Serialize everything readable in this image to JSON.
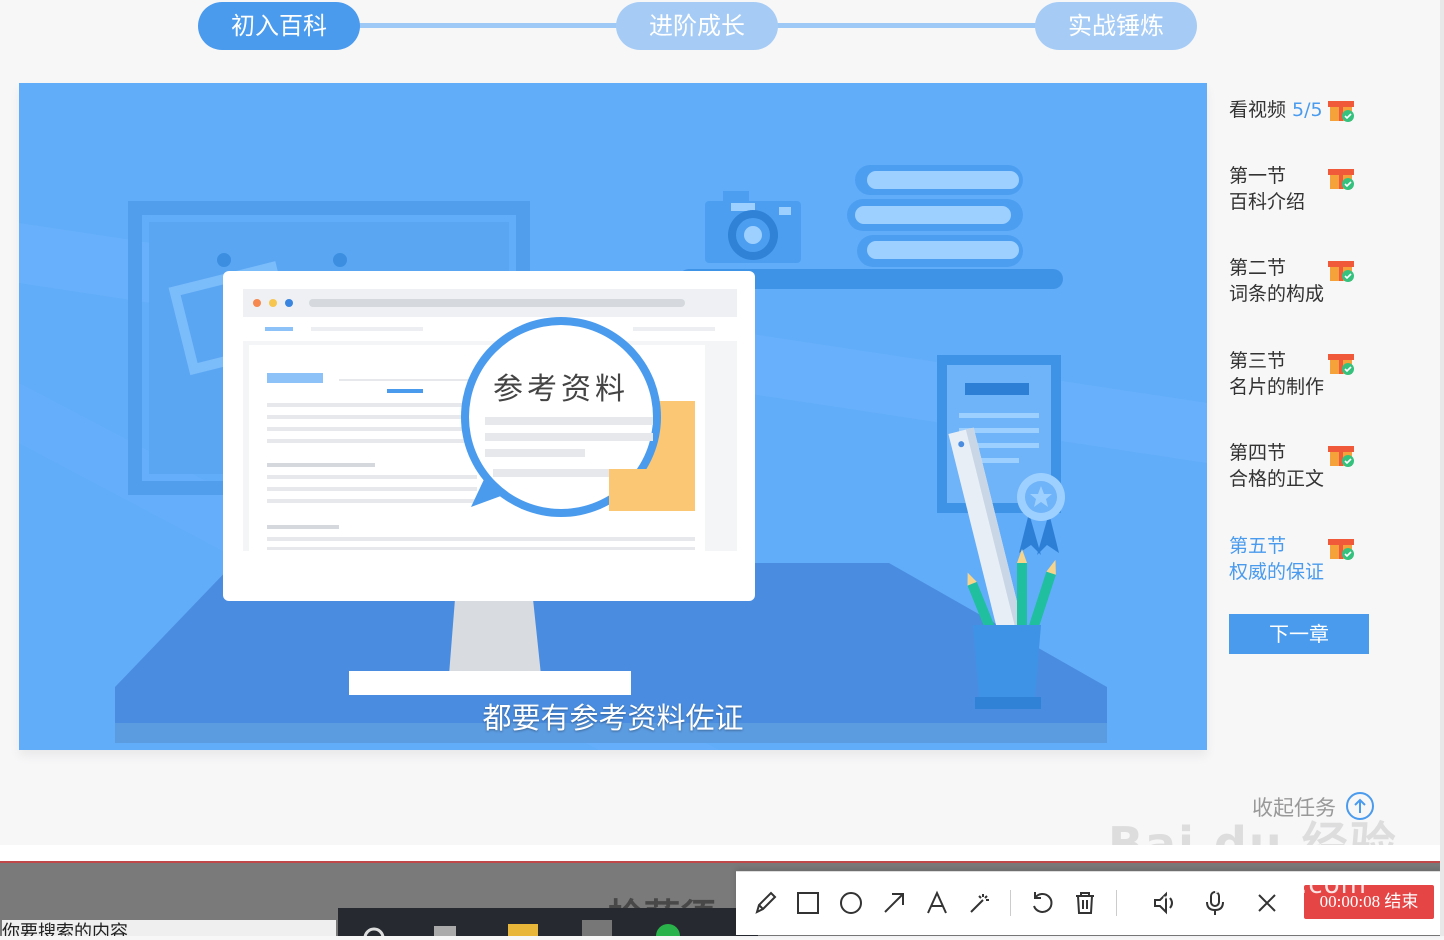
{
  "stepper": {
    "steps": [
      "初入百科",
      "进阶成长",
      "实战锤炼"
    ],
    "active_index": 0
  },
  "video": {
    "subtitle": "都要有参考资料佐证",
    "bubble_text": "参考资料",
    "colors": {
      "background": "#62adfa",
      "accent": "#4a9bee"
    }
  },
  "sidebar": {
    "video_label": "看视频",
    "video_progress": "5/5",
    "sections": [
      {
        "line1": "第一节",
        "line2": "百科介绍",
        "current": false
      },
      {
        "line1": "第二节",
        "line2": "词条的构成",
        "current": false
      },
      {
        "line1": "第三节",
        "line2": "名片的制作",
        "current": false
      },
      {
        "line1": "第四节",
        "line2": "合格的正文",
        "current": false
      },
      {
        "line1": "第五节",
        "line2": "权威的保证",
        "current": true
      }
    ],
    "next_button": "下一章",
    "collapse_label": "收起任务"
  },
  "watermark": {
    "logo": "Bai du 经验",
    "url": "jingyan.baidu.com"
  },
  "background_window": {
    "search_hint": "你要搜索的内容",
    "title_fragment": "检萨须"
  },
  "recorder": {
    "tools": [
      "pencil-icon",
      "rectangle-icon",
      "circle-icon",
      "arrow-icon",
      "text-icon",
      "magic-wand-icon",
      "undo-icon",
      "trash-icon",
      "speaker-icon",
      "microphone-icon",
      "close-icon"
    ],
    "timer": "00:00:08",
    "end_label": "结束"
  }
}
